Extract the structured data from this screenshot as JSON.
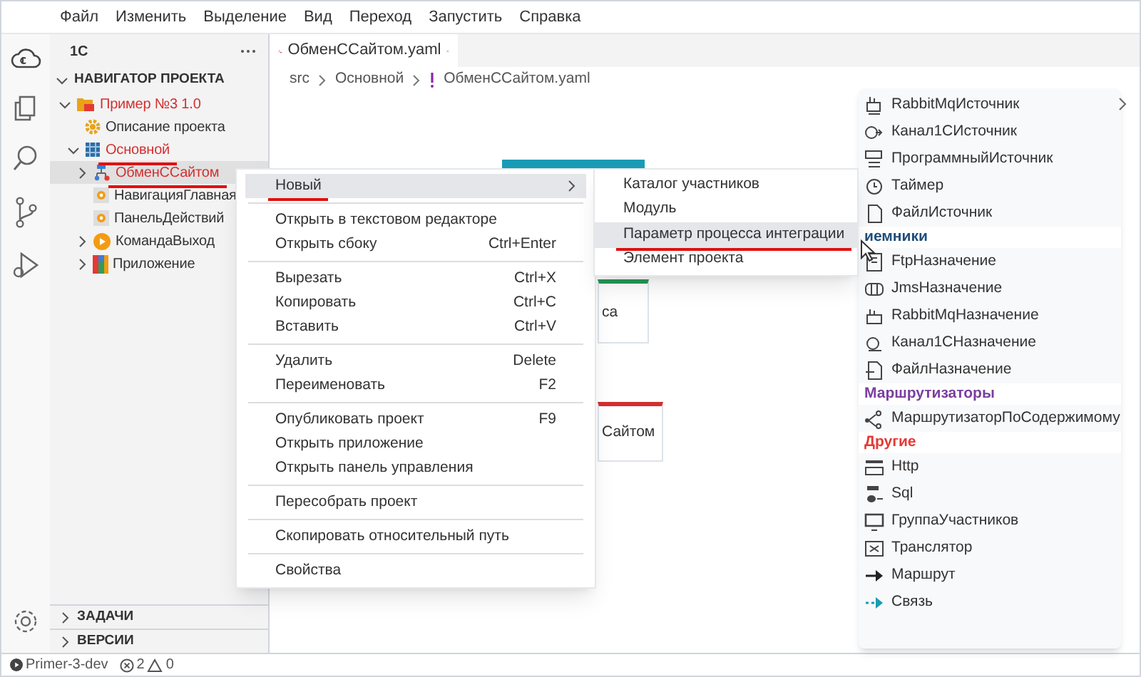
{
  "menu_bar": [
    "Файл",
    "Изменить",
    "Выделение",
    "Вид",
    "Переход",
    "Запустить",
    "Справка"
  ],
  "sidebar": {
    "title": "1С",
    "section": {
      "label": "НАВИГАТОР ПРОЕКТА",
      "expanded": true
    },
    "tree": [
      {
        "label": "Пример №3 1.0",
        "kind": "project",
        "expanded": true,
        "modified": true,
        "selected": false,
        "annotated": false,
        "children": [
          {
            "label": "Описание проекта",
            "kind": "gear",
            "modified": false,
            "selected": false,
            "annotated": false
          },
          {
            "label": "Основной",
            "kind": "module",
            "expanded": true,
            "modified": true,
            "selected": false,
            "annotated": true,
            "children": [
              {
                "label": "ОбменССайтом",
                "kind": "flow",
                "expanded": false,
                "modified": true,
                "selected": true,
                "annotated": true
              },
              {
                "label": "НавигацияГлавная",
                "kind": "page",
                "modified": false,
                "selected": false,
                "annotated": false
              },
              {
                "label": "ПанельДействий",
                "kind": "page",
                "modified": false,
                "selected": false,
                "annotated": false
              },
              {
                "label": "КомандаВыход",
                "kind": "command",
                "expanded": false,
                "modified": false,
                "selected": false,
                "annotated": false
              },
              {
                "label": "Приложение",
                "kind": "app",
                "expanded": false,
                "modified": false,
                "selected": false,
                "annotated": false
              }
            ]
          }
        ]
      }
    ],
    "bottom_sections": [
      {
        "label": "ЗАДАЧИ",
        "expanded": false
      },
      {
        "label": "ВЕРСИИ",
        "expanded": false
      }
    ]
  },
  "editor": {
    "tab": {
      "label": "ОбменССайтом.yaml"
    },
    "breadcrumb": [
      "src",
      "Основной",
      "ОбменССайтом.yaml"
    ],
    "canvas_nodes": [
      {
        "label": "са",
        "color": "#239b56"
      },
      {
        "label": "Сайтом",
        "color": "#d32f2f"
      }
    ]
  },
  "context_menu": [
    [
      {
        "label": "Новый",
        "submenu": true,
        "selected": true,
        "annotated": true
      }
    ],
    [
      {
        "label": "Открыть в текстовом редакторе",
        "submenu": false,
        "selected": false,
        "annotated": false
      },
      {
        "label": "Открыть сбоку",
        "shortcut": "Ctrl+Enter",
        "submenu": false,
        "selected": false,
        "annotated": false
      }
    ],
    [
      {
        "label": "Вырезать",
        "shortcut": "Ctrl+X",
        "submenu": false,
        "selected": false,
        "annotated": false
      },
      {
        "label": "Копировать",
        "shortcut": "Ctrl+C",
        "submenu": false,
        "selected": false,
        "annotated": false
      },
      {
        "label": "Вставить",
        "shortcut": "Ctrl+V",
        "submenu": false,
        "selected": false,
        "annotated": false
      }
    ],
    [
      {
        "label": "Удалить",
        "shortcut": "Delete",
        "submenu": false,
        "selected": false,
        "annotated": false
      },
      {
        "label": "Переименовать",
        "shortcut": "F2",
        "submenu": false,
        "selected": false,
        "annotated": false
      }
    ],
    [
      {
        "label": "Опубликовать проект",
        "shortcut": "F9",
        "submenu": false,
        "selected": false,
        "annotated": false
      },
      {
        "label": "Открыть приложение",
        "submenu": false,
        "selected": false,
        "annotated": false
      },
      {
        "label": "Открыть панель управления",
        "submenu": false,
        "selected": false,
        "annotated": false
      }
    ],
    [
      {
        "label": "Пересобрать проект",
        "submenu": false,
        "selected": false,
        "annotated": false
      }
    ],
    [
      {
        "label": "Скопировать относительный путь",
        "submenu": false,
        "selected": false,
        "annotated": false
      }
    ],
    [
      {
        "label": "Свойства",
        "submenu": false,
        "selected": false,
        "annotated": false
      }
    ]
  ],
  "submenu": [
    {
      "label": "Каталог участников",
      "selected": false,
      "annotated": false
    },
    {
      "label": "Модуль",
      "selected": false,
      "annotated": false
    },
    {
      "label": "Параметр процесса интеграции",
      "selected": true,
      "annotated": true
    },
    {
      "label": "Элемент проекта",
      "selected": false,
      "annotated": false
    }
  ],
  "palette": [
    {
      "kind": "item",
      "label": "RabbitMqИсточник"
    },
    {
      "kind": "item",
      "label": "Канал1СИсточник"
    },
    {
      "kind": "item",
      "label": "ПрограммныйИсточник"
    },
    {
      "kind": "item",
      "label": "Таймер"
    },
    {
      "kind": "item",
      "label": "ФайлИсточник"
    },
    {
      "kind": "header",
      "label": "иемники",
      "color": "#1f4e79"
    },
    {
      "kind": "item",
      "label": "FtpНазначение"
    },
    {
      "kind": "item",
      "label": "JmsНазначение"
    },
    {
      "kind": "item",
      "label": "RabbitMqНазначение"
    },
    {
      "kind": "item",
      "label": "Канал1СНазначение"
    },
    {
      "kind": "item",
      "label": "ФайлНазначение"
    },
    {
      "kind": "header",
      "label": "Маршрутизаторы",
      "color": "#7b3fa0"
    },
    {
      "kind": "item",
      "label": "МаршрутизаторПоСодержимому"
    },
    {
      "kind": "header",
      "label": "Другие",
      "color": "#e53935"
    },
    {
      "kind": "item",
      "label": "Http"
    },
    {
      "kind": "item",
      "label": "Sql"
    },
    {
      "kind": "item",
      "label": "ГруппаУчастников"
    },
    {
      "kind": "item",
      "label": "Транслятор"
    },
    {
      "kind": "item",
      "label": "Маршрут"
    },
    {
      "kind": "item",
      "label": "Связь"
    }
  ],
  "status_bar": {
    "branch": "Primer-3-dev",
    "errors": "2",
    "warnings": "0"
  }
}
